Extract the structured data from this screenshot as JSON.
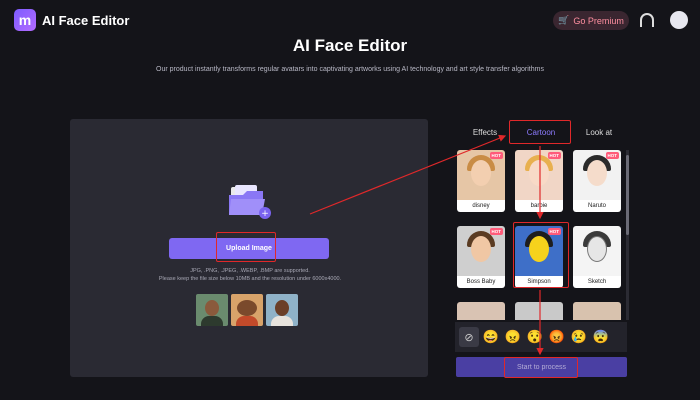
{
  "header": {
    "logo_letter": "m",
    "app_title": "AI Face Editor",
    "premium_label": "Go Premium"
  },
  "main": {
    "title": "AI Face Editor",
    "subtitle": "Our product instantly transforms regular avatars into captivating artworks using AI technology and art style transfer algorithms"
  },
  "upload": {
    "button_label": "Upload Image",
    "hint_line1": "JPG, .PNG, .JPEG, .WEBP, .BMP are supported.",
    "hint_line2": "Please keep the file size below 10MB and the resolution under 6000x4000."
  },
  "tabs": [
    {
      "label": "Effects"
    },
    {
      "label": "Cartoon",
      "active": true
    },
    {
      "label": "Look at"
    }
  ],
  "styles": [
    {
      "label": "disney",
      "hot": "HOT"
    },
    {
      "label": "barbie",
      "hot": "HOT"
    },
    {
      "label": "Naruto",
      "hot": "HOT"
    },
    {
      "label": "Boss Baby",
      "hot": "HOT"
    },
    {
      "label": "Simpson",
      "hot": "HOT"
    },
    {
      "label": "Sketch",
      "hot": ""
    }
  ],
  "emojis": [
    "⊘",
    "😄",
    "😠",
    "😯",
    "😡",
    "😢",
    "😨"
  ],
  "process_label": "Start to process",
  "colors": {
    "accent": "#7f68f2",
    "highlight": "#e0282a",
    "background": "#141419"
  }
}
